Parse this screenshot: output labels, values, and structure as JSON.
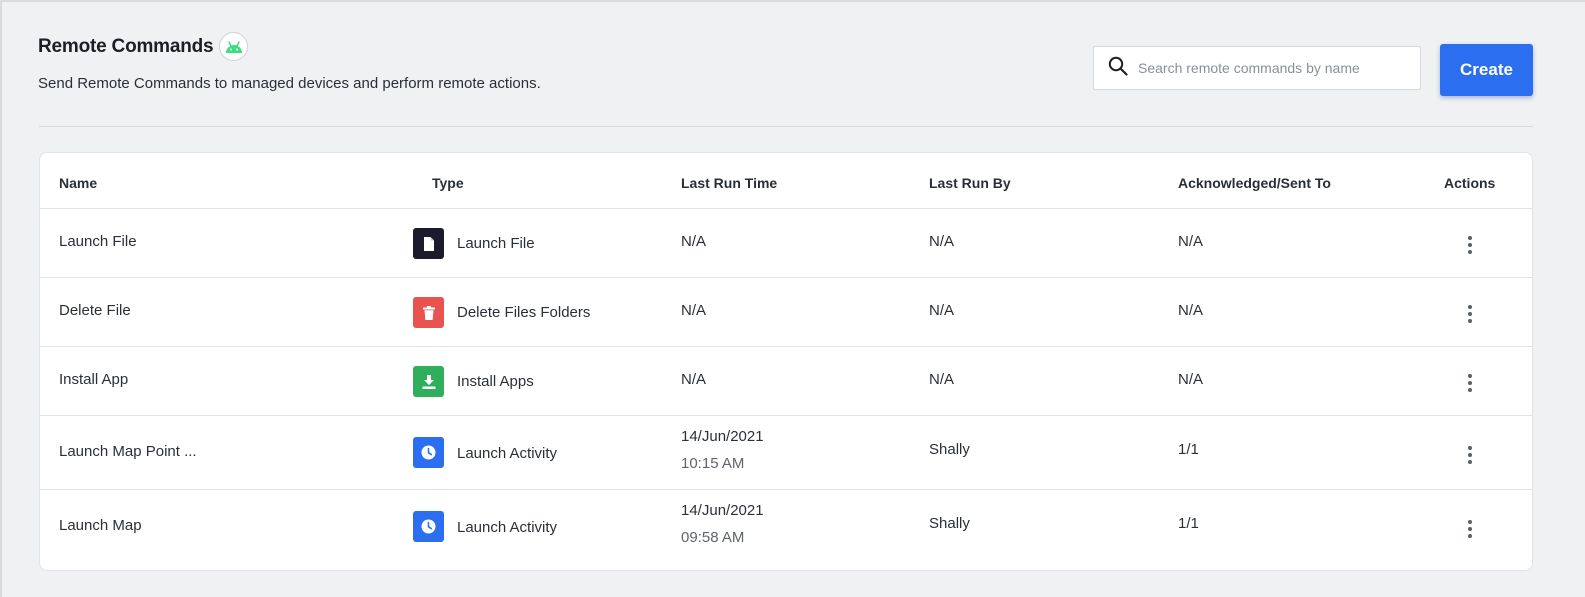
{
  "header": {
    "title": "Remote Commands",
    "subtitle": "Send Remote Commands to managed devices and perform remote actions.",
    "platform_icon": "android-icon",
    "accent_android": "#3ddc84"
  },
  "search": {
    "placeholder": "Search remote commands by name",
    "value": ""
  },
  "toolbar": {
    "create_label": "Create",
    "accent": "#2b6ff0"
  },
  "table": {
    "columns": [
      "Name",
      "Type",
      "Last Run Time",
      "Last Run By",
      "Acknowledged/Sent To",
      "Actions"
    ],
    "rows": [
      {
        "name": "Launch File",
        "type_label": "Launch File",
        "type_icon": "file-icon",
        "type_color": "#1c1b2e",
        "last_run_date": "N/A",
        "last_run_time": "",
        "last_run_by": "N/A",
        "ack_sent": "N/A"
      },
      {
        "name": "Delete File",
        "type_label": "Delete Files Folders",
        "type_icon": "trash-icon",
        "type_color": "#e9534f",
        "last_run_date": "N/A",
        "last_run_time": "",
        "last_run_by": "N/A",
        "ack_sent": "N/A"
      },
      {
        "name": "Install App",
        "type_label": "Install Apps",
        "type_icon": "download-icon",
        "type_color": "#2fae5c",
        "last_run_date": "N/A",
        "last_run_time": "",
        "last_run_by": "N/A",
        "ack_sent": "N/A"
      },
      {
        "name": "Launch Map Point ...",
        "type_label": "Launch Activity",
        "type_icon": "clock-icon",
        "type_color": "#2b6ff0",
        "last_run_date": "14/Jun/2021",
        "last_run_time": "10:15 AM",
        "last_run_by": "Shally",
        "ack_sent": "1/1"
      },
      {
        "name": "Launch Map",
        "type_label": "Launch Activity",
        "type_icon": "clock-icon",
        "type_color": "#2b6ff0",
        "last_run_date": "14/Jun/2021",
        "last_run_time": "09:58 AM",
        "last_run_by": "Shally",
        "ack_sent": "1/1"
      }
    ]
  }
}
